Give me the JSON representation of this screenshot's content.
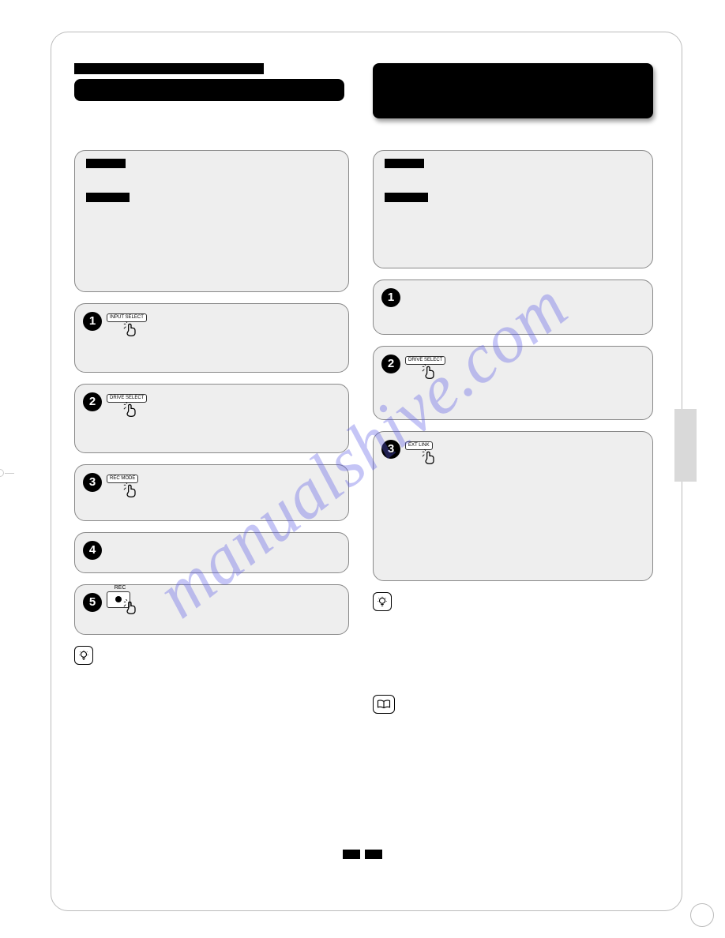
{
  "watermark": "manualshive.com",
  "left": {
    "steps": {
      "s1": {
        "num": "1",
        "button_label": "INPUT SELECT"
      },
      "s2": {
        "num": "2",
        "button_label": "DRIVE SELECT"
      },
      "s3": {
        "num": "3",
        "button_label": "REC MODE"
      },
      "s4": {
        "num": "4"
      },
      "s5": {
        "num": "5",
        "button_label": "REC"
      }
    }
  },
  "right": {
    "steps": {
      "s1": {
        "num": "1"
      },
      "s2": {
        "num": "2",
        "button_label": "DRIVE SELECT"
      },
      "s3": {
        "num": "3",
        "button_label": "EXT LINK"
      }
    }
  },
  "icons": {
    "tip": "lightbulb-icon",
    "book": "open-book-icon",
    "hand": "press-hand-icon"
  }
}
